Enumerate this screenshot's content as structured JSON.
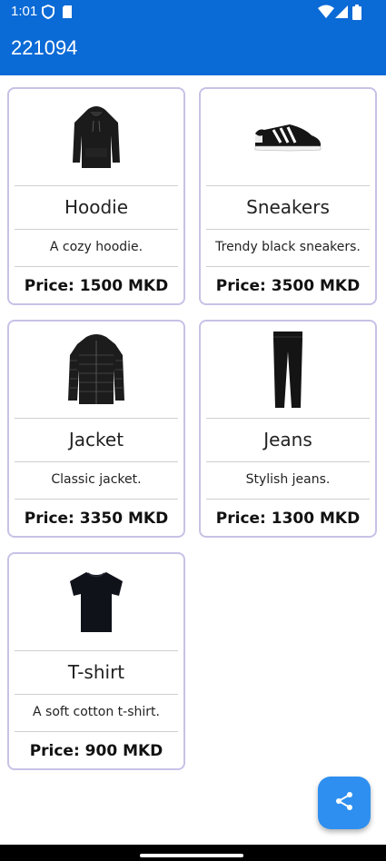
{
  "status_bar": {
    "time": "1:01",
    "icons": [
      "shield-icon",
      "sd-card-icon",
      "wifi-icon",
      "signal-icon",
      "battery-icon"
    ]
  },
  "app_bar": {
    "title": "221094"
  },
  "products": [
    {
      "name": "Hoodie",
      "description": "A cozy hoodie.",
      "price": "Price: 1500 MKD",
      "image": "hoodie-image"
    },
    {
      "name": "Sneakers",
      "description": "Trendy black sneakers.",
      "price": "Price: 3500 MKD",
      "image": "sneakers-image"
    },
    {
      "name": "Jacket",
      "description": "Classic jacket.",
      "price": "Price: 3350 MKD",
      "image": "jacket-image"
    },
    {
      "name": "Jeans",
      "description": "Stylish jeans.",
      "price": "Price: 1300 MKD",
      "image": "jeans-image"
    },
    {
      "name": "T-shirt",
      "description": "A soft cotton t-shirt.",
      "price": "Price: 900 MKD",
      "image": "tshirt-image"
    }
  ],
  "fab": {
    "icon": "share-icon"
  },
  "colors": {
    "app_bar": "#0a6ad6",
    "card_border": "#c7c2e6",
    "fab": "#2e8ff0"
  }
}
